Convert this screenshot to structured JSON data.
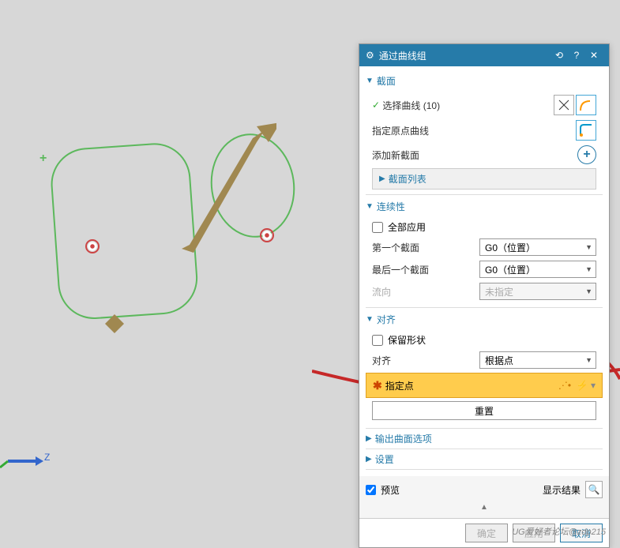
{
  "titlebar": {
    "icon": "⚙",
    "title": "通过曲线组"
  },
  "sections": {
    "crossSection": {
      "label": "截面",
      "selectCurve": "选择曲线 (10)",
      "specifyOrigin": "指定原点曲线",
      "addNew": "添加新截面",
      "list": "截面列表"
    },
    "continuity": {
      "label": "连续性",
      "applyAll": "全部应用",
      "first": "第一个截面",
      "last": "最后一个截面",
      "flow": "流向",
      "opt": "G0（位置）",
      "flowOpt": "未指定"
    },
    "align": {
      "label": "对齐",
      "preserve": "保留形状",
      "alignLabel": "对齐",
      "alignOpt": "根据点",
      "specifyPoint": "指定点",
      "reset": "重置"
    },
    "output": {
      "label": "输出曲面选项"
    },
    "settings": {
      "label": "设置"
    }
  },
  "footer": {
    "preview": "预览",
    "showResult": "显示结果"
  },
  "buttons": {
    "ok": "确定",
    "apply": "应用",
    "cancel": "取消"
  },
  "watermark": "UG爱好者论坛@zdp215",
  "axisLabel": "Z"
}
